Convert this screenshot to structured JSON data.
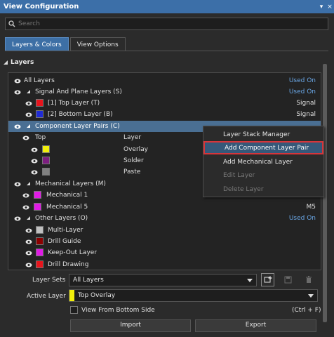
{
  "window": {
    "title": "View Configuration",
    "pin_glyph": "▾",
    "close_glyph": "×"
  },
  "search": {
    "placeholder": "Search"
  },
  "tabs": [
    {
      "label": "Layers & Colors"
    },
    {
      "label": "View Options"
    }
  ],
  "section": {
    "label": "Layers"
  },
  "grid": {
    "all_layers": {
      "label": "All Layers",
      "value": "Used On"
    },
    "signal_group": {
      "label": "Signal And Plane Layers (S)",
      "value": "Used On"
    },
    "signal_layers": [
      {
        "label": "[1] Top Layer (T)",
        "value": "Signal",
        "color": "#e8141c"
      },
      {
        "label": "[2] Bottom Layer (B)",
        "value": "Signal",
        "color": "#1f2bd6"
      }
    ],
    "component_group": {
      "label": "Component Layer Pairs (C)"
    },
    "pair_header": {
      "label": "Top",
      "col": "Layer"
    },
    "pair_layers": [
      {
        "label": "Overlay",
        "color": "#f2ef0b"
      },
      {
        "label": "Solder",
        "color": "#7d1e80"
      },
      {
        "label": "Paste",
        "color": "#808080"
      }
    ],
    "mechanical_group": {
      "label": "Mechanical Layers (M)"
    },
    "mechanical_layers": [
      {
        "label": "Mechanical 1",
        "value": "",
        "color": "#e11be6"
      },
      {
        "label": "Mechanical 5",
        "value": "M5",
        "color": "#e11be6"
      }
    ],
    "other_group": {
      "label": "Other Layers (O)",
      "value": "Used On"
    },
    "other_layers": [
      {
        "label": "Multi-Layer",
        "color": "#c0c0c0"
      },
      {
        "label": "Drill Guide",
        "color": "#8b0000"
      },
      {
        "label": "Keep-Out Layer",
        "color": "#e11be6"
      },
      {
        "label": "Drill Drawing",
        "color": "#e8141c"
      }
    ]
  },
  "context_menu": {
    "items": [
      {
        "label": "Layer Stack Manager",
        "enabled": true
      },
      {
        "label": "Add Component Layer Pair",
        "enabled": true,
        "highlighted": true
      },
      {
        "label": "Add Mechanical Layer",
        "enabled": true
      },
      {
        "label": "Edit Layer",
        "enabled": false
      },
      {
        "label": "Delete Layer",
        "enabled": false
      }
    ]
  },
  "layer_sets": {
    "label": "Layer Sets",
    "value": "All Layers"
  },
  "active_layer": {
    "label": "Active Layer",
    "value": "Top Overlay",
    "color": "#f2ef0b"
  },
  "view_bottom": {
    "label": "View From Bottom Side",
    "shortcut": "(Ctrl + F)",
    "checked": false
  },
  "buttons": {
    "import": "Import",
    "export": "Export"
  },
  "colors": {
    "accent": "#3c6fa8",
    "selected_row": "#4a6f93",
    "highlight_border": "#d6353a"
  }
}
